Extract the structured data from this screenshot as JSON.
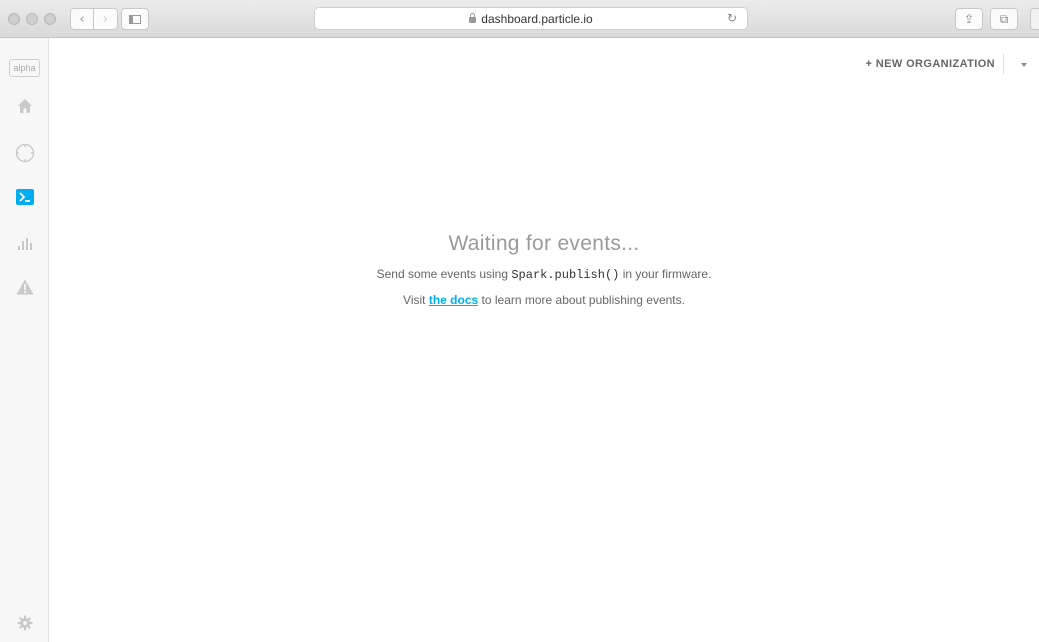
{
  "browser": {
    "url": "dashboard.particle.io",
    "back_icon": "‹",
    "forward_icon": "›",
    "reload_icon": "↻",
    "share_icon": "⇪",
    "tabs_icon": "⧉"
  },
  "sidebar": {
    "badge": "alpha",
    "items": [
      {
        "name": "home",
        "icon": "home-icon"
      },
      {
        "name": "devices",
        "icon": "crosshair-icon"
      },
      {
        "name": "console",
        "icon": "terminal-icon",
        "active": true,
        "accent": "#00aeef"
      },
      {
        "name": "stats",
        "icon": "bar-chart-icon"
      },
      {
        "name": "alerts",
        "icon": "warning-icon"
      }
    ],
    "settings_icon": "gear-icon"
  },
  "header": {
    "new_org_label": "+ NEW ORGANIZATION"
  },
  "main": {
    "title": "Waiting for events...",
    "line1_before": "Send some events using ",
    "line1_code": "Spark.publish()",
    "line1_after": " in your firmware.",
    "line2_before": "Visit ",
    "line2_link": "the docs",
    "line2_after": " to learn more about publishing events."
  },
  "colors": {
    "accent": "#00aeef",
    "sidebar_bg": "#f7f7f7",
    "icon_muted": "#c9c9c9"
  }
}
